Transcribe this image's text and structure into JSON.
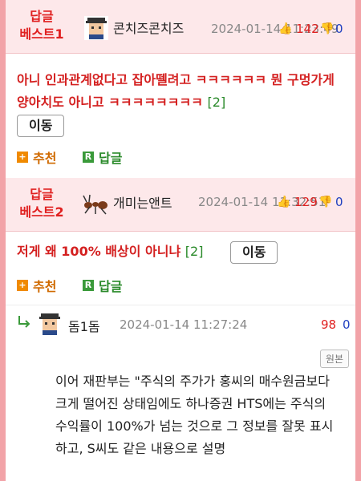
{
  "best1": {
    "label": "답글\n베스트1",
    "nickname": "콘치즈콘치즈",
    "date": "2024-01-14 11:23:49",
    "up_count": "142",
    "down_count": "0",
    "text": "아니 인과관계없다고 잡아뗄려고 ㅋㅋㅋㅋㅋㅋ 뭔 구멍가게 양아치도 아니고 ㅋㅋㅋㅋㅋㅋㅋㅋ",
    "reply_count": "[2]",
    "move_label": "이동",
    "recommend_label": "추천",
    "reply_label": "답글"
  },
  "best2": {
    "label": "답글\n베스트2",
    "nickname": "개미는앤트",
    "date": "2024-01-14 11:32:51",
    "up_count": "129",
    "down_count": "0",
    "text": "저게 왜 100% 배상이 아니냐",
    "reply_count": "[2]",
    "move_label": "이동",
    "recommend_label": "추천",
    "reply_label": "답글"
  },
  "reply": {
    "nickname": "돔1돔",
    "date": "2024-01-14 11:27:24",
    "up_count": "98",
    "down_count": "0",
    "origin_label": "원본",
    "body": "이어 재판부는 \"주식의 주가가 홍씨의 매수원금보다 크게 떨어진 상태임에도 하나증권 HTS에는 주식의 수익률이 100%가 넘는 것으로 그 정보를 잘못 표시하고, S씨도 같은 내용으로 설명"
  },
  "icons": {
    "thumb_up": "thumbs-up-icon",
    "thumb_down": "thumbs-down-icon",
    "reply_arrow": "reply-arrow-icon"
  }
}
